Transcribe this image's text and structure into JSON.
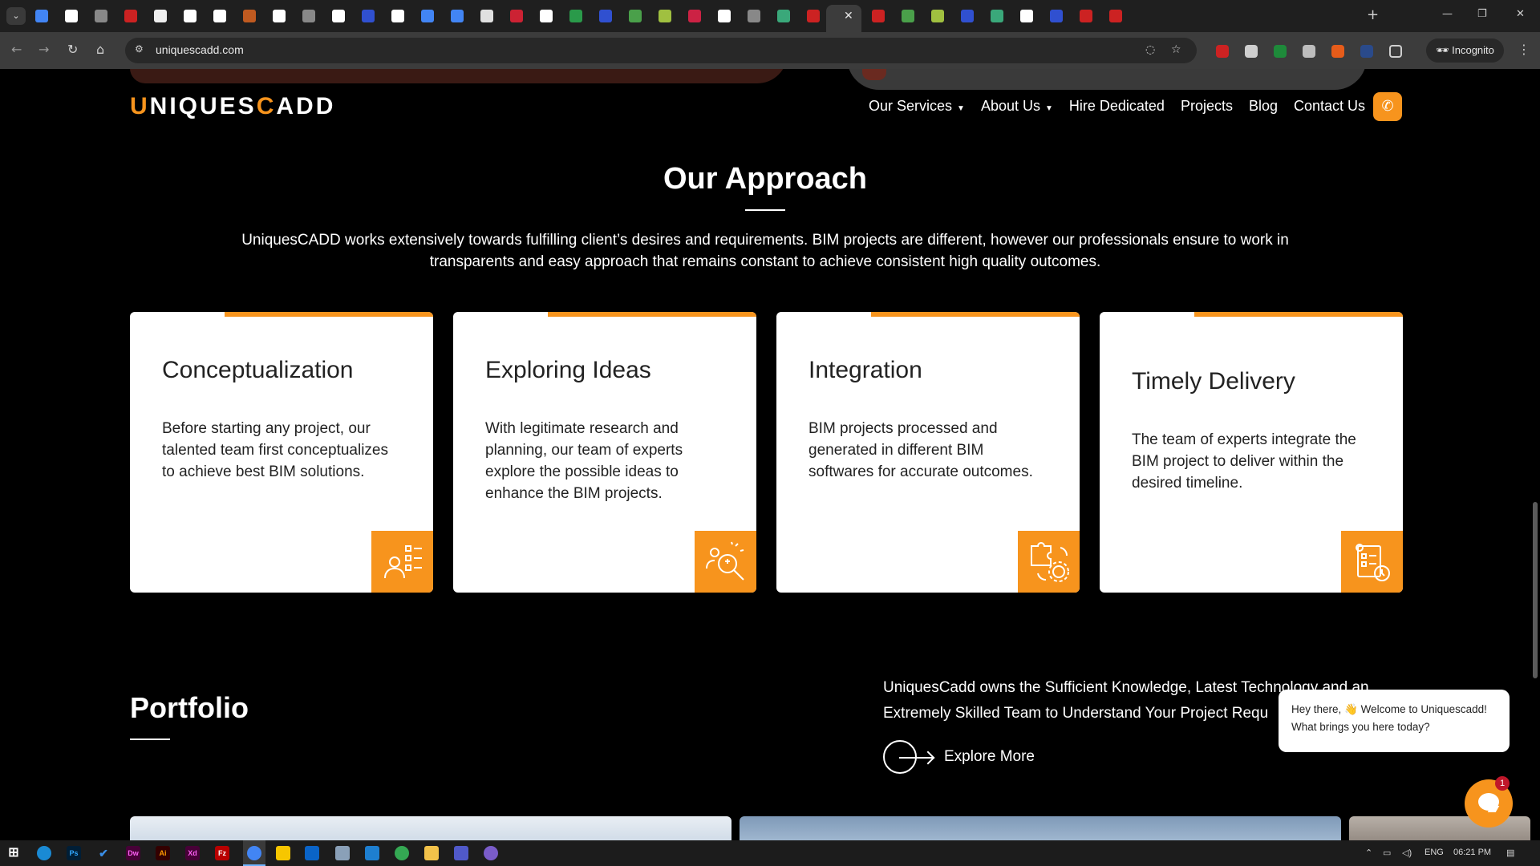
{
  "browser": {
    "active_tab_close": "✕",
    "new_tab": "+",
    "window_controls": [
      "—",
      "❐",
      "✕"
    ],
    "url": "uniquescadd.com",
    "incognito_label": "Incognito",
    "tab_favicon_colors": [
      "#4285f4",
      "#ffffff",
      "#888888",
      "#cc2222",
      "#eeeeee",
      "#ffffff",
      "#ffffff",
      "#c05a20",
      "#ffffff",
      "#888888",
      "#ffffff",
      "#3050d0",
      "#ffffff",
      "#4285f4",
      "#4285f4",
      "#e0e0e0",
      "#cc2233",
      "#ffffff",
      "#2a9a4a",
      "#3050d0",
      "#4aa04a",
      "#a0c040",
      "#cc2244",
      "#ffffff",
      "#888888",
      "#3aa87a",
      "#cc2222",
      "#cc2222",
      "#4aa04a",
      "#a0c040",
      "#3050d0",
      "#3aa87a",
      "#ffffff",
      "#3050d0",
      "#cc2222",
      "#cc2222"
    ]
  },
  "site": {
    "logo": {
      "part1": "U",
      "part2": "NIQUES",
      "part3": "C",
      "part4": "ADD"
    },
    "nav": {
      "services": "Our Services",
      "about": "About Us",
      "hire": "Hire Dedicated",
      "projects": "Projects",
      "blog": "Blog",
      "contact": "Contact Us"
    },
    "approach": {
      "title": "Our Approach",
      "description": "UniquesCADD works extensively towards fulfilling client’s desires and requirements. BIM projects are different, however our professionals ensure to work in transparents and easy approach that remains constant to achieve consistent high quality outcomes.",
      "cards": [
        {
          "title": "Conceptualization",
          "body": "Before starting any project, our talented team first conceptualizes to achieve best BIM solutions.",
          "icon": "team-checklist-icon"
        },
        {
          "title": "Exploring Ideas",
          "body": "With legitimate research and planning, our team of experts explore the possible ideas to enhance the BIM projects.",
          "icon": "idea-search-icon"
        },
        {
          "title": "Integration",
          "body": "BIM projects processed and generated in different BIM softwares for accurate outcomes.",
          "icon": "puzzle-gear-icon"
        },
        {
          "title": "Timely Delivery",
          "body": "The team of experts integrate the BIM project to deliver within the desired timeline.",
          "icon": "document-clock-icon"
        }
      ]
    },
    "portfolio": {
      "title": "Portfolio",
      "description_line1": "UniquesCadd owns the Sufficient Knowledge, Latest Technology and an",
      "description_line2": "Extremely Skilled Team to Understand Your Project Requ",
      "explore": "Explore More"
    },
    "chat": {
      "line1": "Hey there, 👋 Welcome to Uniquescadd!",
      "line2": "What brings you here today?",
      "badge": "1"
    },
    "accent_color": "#f7941d"
  },
  "taskbar": {
    "apps": [
      "Ps",
      "Dw",
      "Ai",
      "Xd",
      "Fz"
    ],
    "tray_lang": "ENG",
    "time": "06:21 PM"
  }
}
